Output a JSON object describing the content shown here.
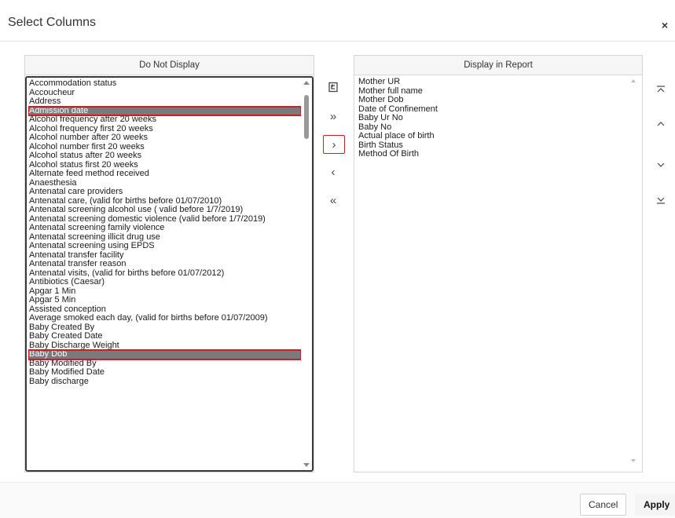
{
  "dialog": {
    "title": "Select Columns",
    "close_glyph": "×"
  },
  "left_panel": {
    "header": "Do Not Display",
    "items": [
      "Accommodation status",
      "Accoucheur",
      "Address",
      "Admission date",
      "Alcohol frequency after 20 weeks",
      "Alcohol frequency first 20 weeks",
      "Alcohol number after 20 weeks",
      "Alcohol number first 20 weeks",
      "Alcohol status after 20 weeks",
      "Alcohol status first 20 weeks",
      "Alternate feed method received",
      "Anaesthesia",
      "Antenatal care providers",
      "Antenatal care, (valid for births before 01/07/2010)",
      "Antenatal screening alcohol use ( valid before 1/7/2019)",
      "Antenatal screening domestic violence (valid before 1/7/2019)",
      "Antenatal screening family violence",
      "Antenatal screening illicit drug use",
      "Antenatal screening using EPDS",
      "Antenatal transfer facility",
      "Antenatal transfer reason",
      "Antenatal visits, (valid for births before 01/07/2012)",
      "Antibiotics (Caesar)",
      "Apgar 1 Min",
      "Apgar 5 Min",
      "Assisted conception",
      "Average smoked each day, (valid for births before 01/07/2009)",
      "Baby Created By",
      "Baby Created Date",
      "Baby Discharge Weight",
      "Baby Dob",
      "Baby Modified By",
      "Baby Modified Date",
      "Baby discharge"
    ],
    "selected": [
      "Admission date",
      "Baby Dob"
    ]
  },
  "right_panel": {
    "header": "Display in Report",
    "items": [
      "Mother UR",
      "Mother full name",
      "Mother Dob",
      "Date of Confinement",
      "Baby Ur No",
      "Baby No",
      "Actual place of birth",
      "Birth Status",
      "Method Of Birth"
    ]
  },
  "transfer_buttons": {
    "reset": "reset-icon",
    "move_all_right": "»",
    "move_right": "›",
    "move_left": "‹",
    "move_all_left": "«"
  },
  "order_buttons": [
    "move-top-icon",
    "move-up-icon",
    "move-down-icon",
    "move-bottom-icon"
  ],
  "footer": {
    "cancel_label": "Cancel",
    "apply_label": "Apply"
  },
  "colors": {
    "selection_outline": "#c8202a",
    "selection_fill": "#7a7a7a"
  }
}
